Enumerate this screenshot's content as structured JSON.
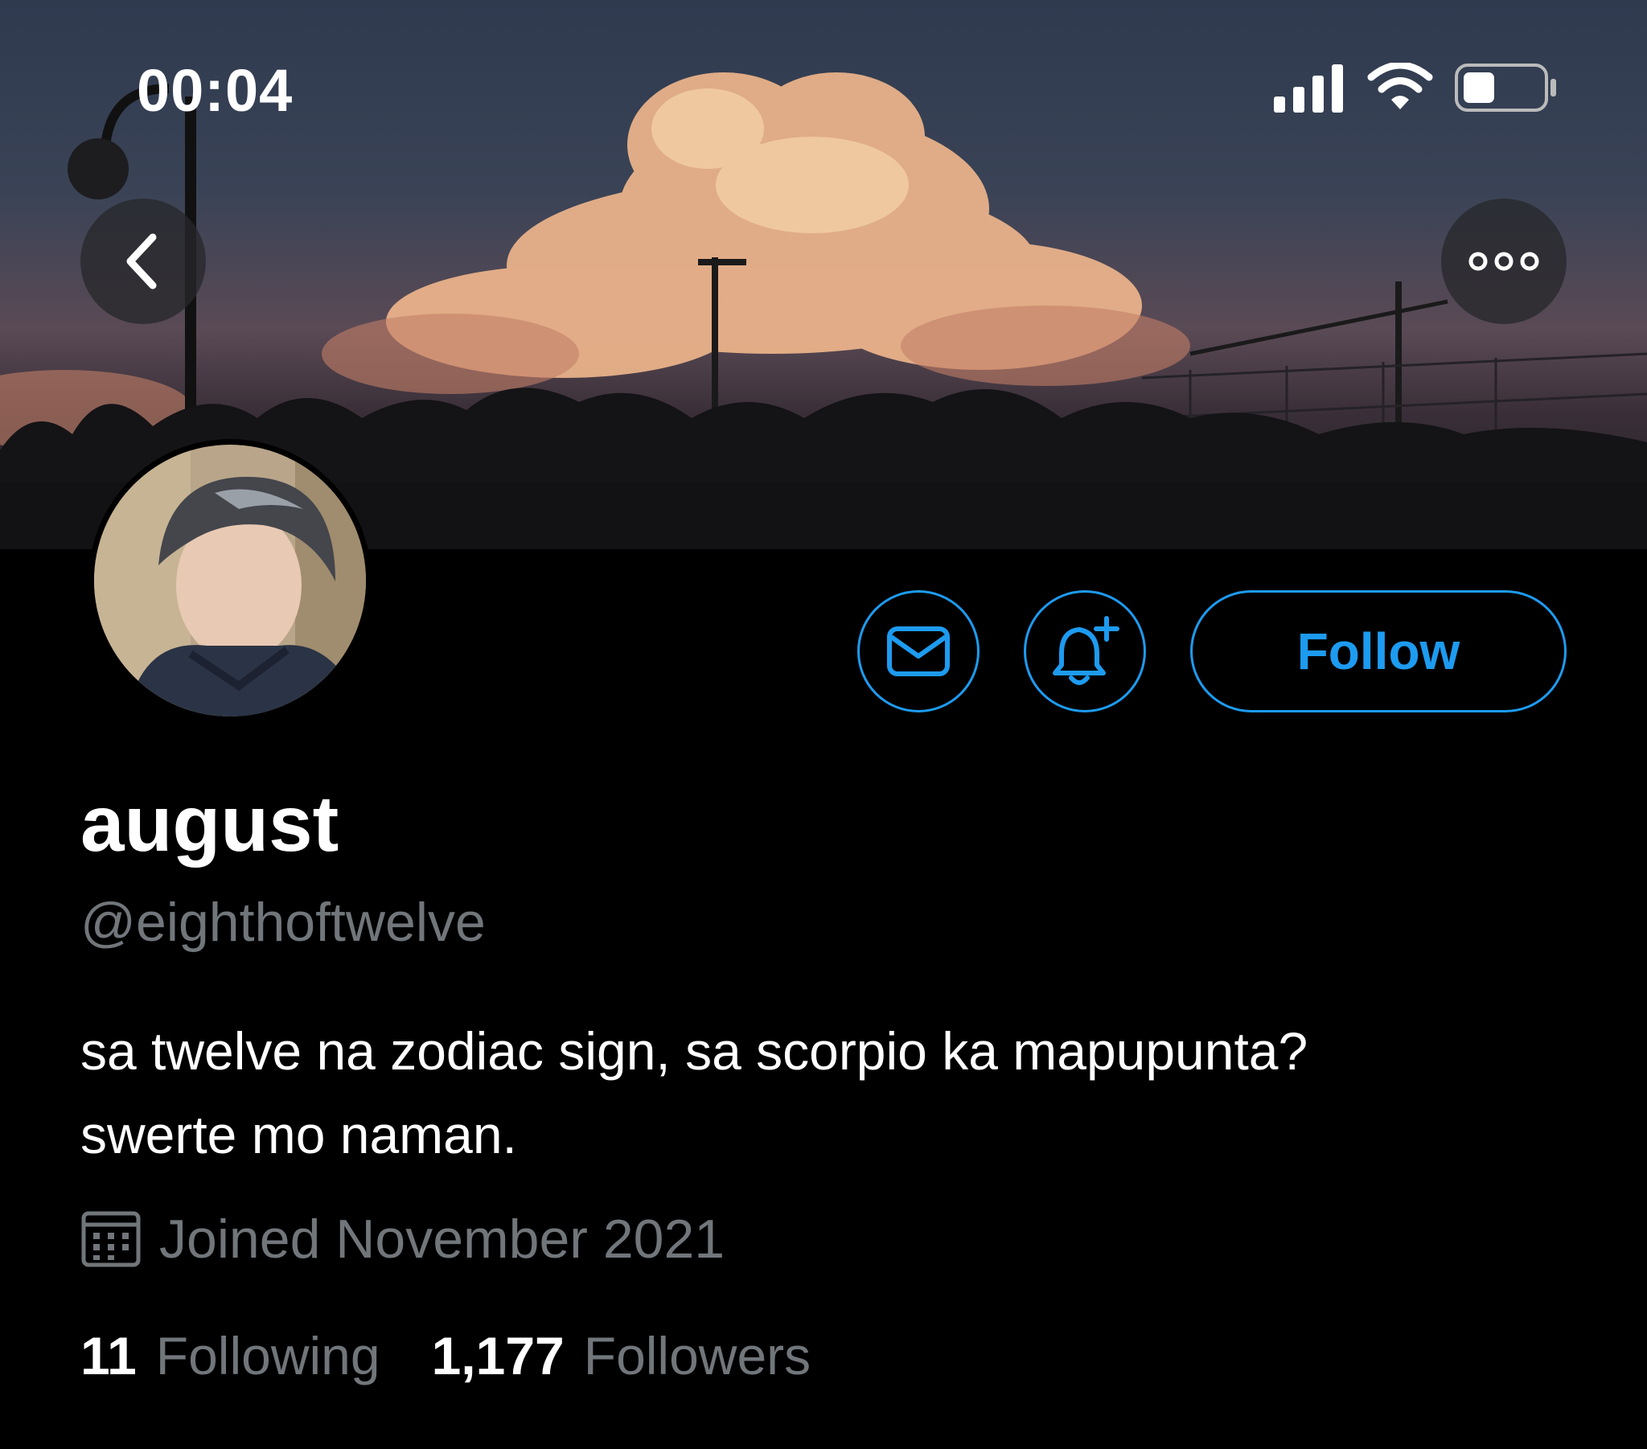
{
  "status_bar": {
    "time": "00:04",
    "icons": [
      "cellular-signal-icon",
      "wifi-icon",
      "battery-icon"
    ]
  },
  "header": {
    "back_icon": "chevron-left-icon",
    "more_icon": "more-horizontal-icon"
  },
  "profile": {
    "display_name": "august",
    "handle": "@eighthoftwelve",
    "bio_line1": "sa twelve na zodiac sign, sa scorpio ka mapupunta?",
    "bio_line2": "swerte mo naman.",
    "joined": "Joined November 2021",
    "following_count": "11",
    "following_label": "Following",
    "followers_count": "1,177",
    "followers_label": "Followers"
  },
  "actions": {
    "message_icon": "envelope-icon",
    "notify_icon": "bell-plus-icon",
    "follow_label": "Follow"
  },
  "colors": {
    "accent": "#1d9bf0",
    "secondary_text": "#71767b",
    "background": "#000000"
  }
}
